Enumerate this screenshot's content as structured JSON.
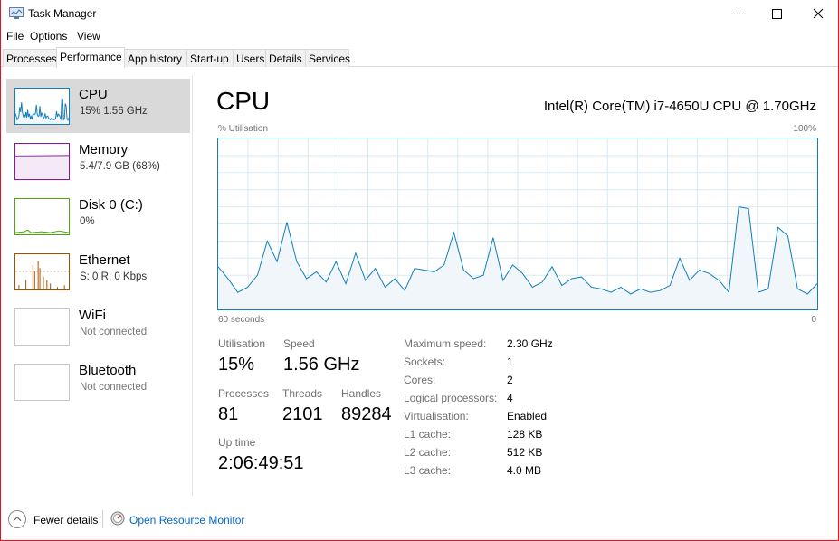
{
  "window": {
    "title": "Task Manager"
  },
  "menu": [
    "File",
    "Options",
    "View"
  ],
  "tabs": [
    {
      "label": "Processes",
      "active": false
    },
    {
      "label": "Performance",
      "active": true
    },
    {
      "label": "App history",
      "active": false
    },
    {
      "label": "Start-up",
      "active": false
    },
    {
      "label": "Users",
      "active": false
    },
    {
      "label": "Details",
      "active": false
    },
    {
      "label": "Services",
      "active": false
    }
  ],
  "sidebar": {
    "items": [
      {
        "title": "CPU",
        "subtitle": "15%  1.56 GHz",
        "color": "#117dbb",
        "selected": true
      },
      {
        "title": "Memory",
        "subtitle": "5.4/7.9 GB (68%)",
        "color": "#8b12ae",
        "selected": false
      },
      {
        "title": "Disk 0 (C:)",
        "subtitle": "0%",
        "color": "#4da60c",
        "selected": false
      },
      {
        "title": "Ethernet",
        "subtitle": "S: 0  R: 0 Kbps",
        "color": "#a74f01",
        "selected": false
      },
      {
        "title": "WiFi",
        "subtitle": "Not connected",
        "color": "#c8c8c8",
        "selected": false
      },
      {
        "title": "Bluetooth",
        "subtitle": "Not connected",
        "color": "#c8c8c8",
        "selected": false
      }
    ]
  },
  "main": {
    "title": "CPU",
    "cpu_name": "Intel(R) Core(TM) i7-4650U CPU @ 1.70GHz",
    "graph": {
      "y_label": "% Utilisation",
      "y_max_label": "100%",
      "x_left_label": "60 seconds",
      "x_right_label": "0",
      "color": "#117dbb",
      "fill": "#f1f6fa",
      "values": [
        25,
        18,
        10,
        13,
        20,
        40,
        28,
        51,
        28,
        18,
        22,
        16,
        28,
        15,
        33,
        17,
        24,
        13,
        18,
        11,
        24,
        23,
        22,
        26,
        45,
        23,
        18,
        20,
        42,
        17,
        26,
        21,
        13,
        16,
        25,
        14,
        18,
        19,
        13,
        12,
        10,
        13,
        9,
        12,
        10,
        11,
        14,
        30,
        17,
        23,
        21,
        17,
        10,
        60,
        59,
        10,
        12,
        48,
        43,
        12,
        9,
        15
      ]
    },
    "stats": {
      "utilisation": {
        "label": "Utilisation",
        "value": "15%"
      },
      "speed": {
        "label": "Speed",
        "value": "1.56 GHz"
      },
      "processes": {
        "label": "Processes",
        "value": "81"
      },
      "threads": {
        "label": "Threads",
        "value": "2101"
      },
      "handles": {
        "label": "Handles",
        "value": "89284"
      },
      "uptime": {
        "label": "Up time",
        "value": "2:06:49:51"
      }
    },
    "details": [
      {
        "label": "Maximum speed:",
        "value": "2.30 GHz"
      },
      {
        "label": "Sockets:",
        "value": "1"
      },
      {
        "label": "Cores:",
        "value": "2"
      },
      {
        "label": "Logical processors:",
        "value": "4"
      },
      {
        "label": "Virtualisation:",
        "value": "Enabled"
      },
      {
        "label": "L1 cache:",
        "value": "128 KB"
      },
      {
        "label": "L2 cache:",
        "value": "512 KB"
      },
      {
        "label": "L3 cache:",
        "value": "4.0 MB"
      }
    ]
  },
  "footer": {
    "fewer_details": "Fewer details",
    "resource_monitor": "Open Resource Monitor"
  }
}
